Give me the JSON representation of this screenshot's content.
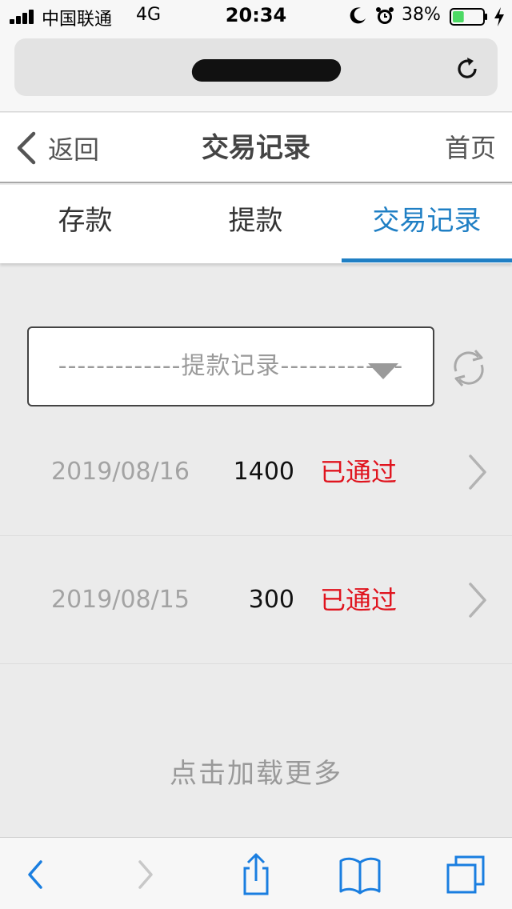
{
  "status_bar": {
    "carrier": "中国联通",
    "network": "4G",
    "time": "20:34",
    "battery_percent": "38%",
    "battery_level": 0.38,
    "battery_color": "#4cd964",
    "icons": [
      "signal-icon",
      "moon-icon",
      "alarm-icon",
      "battery-icon",
      "charging-icon"
    ]
  },
  "url_bar": {
    "url_redacted": true,
    "reload_icon": "reload-icon"
  },
  "nav": {
    "back_label": "返回",
    "title": "交易记录",
    "home_label": "首页"
  },
  "tabs": {
    "items": [
      {
        "label": "存款",
        "active": false
      },
      {
        "label": "提款",
        "active": false
      },
      {
        "label": "交易记录",
        "active": true
      }
    ],
    "active_color": "#1f7fc4"
  },
  "filter": {
    "selected": "-------------提款记录-------------",
    "refresh_icon": "refresh-icon"
  },
  "records": [
    {
      "date": "2019/08/16",
      "amount": "1400",
      "status": "已通过"
    },
    {
      "date": "2019/08/15",
      "amount": "300",
      "status": "已通过"
    }
  ],
  "status_color": "#e0141e",
  "load_more": "点击加载更多",
  "toolbar": {
    "icons": [
      "back-arrow-icon",
      "forward-arrow-icon",
      "share-icon",
      "bookmarks-icon",
      "tabs-icon"
    ],
    "accent": "#1a7ee0"
  }
}
